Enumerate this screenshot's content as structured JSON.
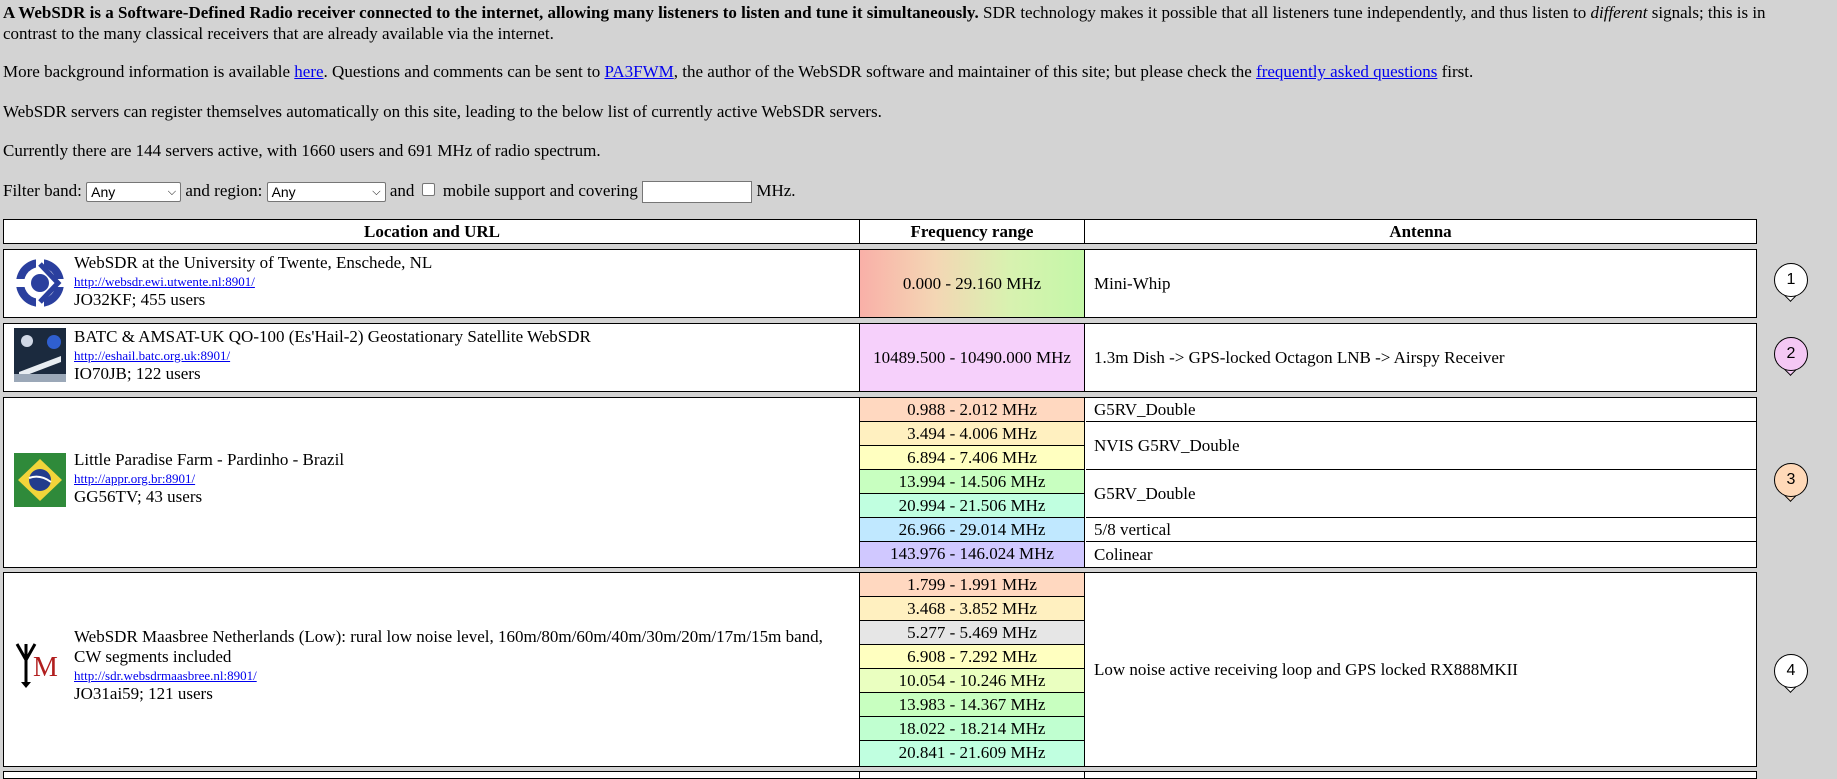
{
  "intro": {
    "bold": "A WebSDR is a Software-Defined Radio receiver connected to the internet, allowing many listeners to listen and tune it simultaneously.",
    "rest1": " SDR technology makes it possible that all listeners tune independently, and thus listen to ",
    "italic": "different",
    "rest2": " signals; this is in",
    "line2": "contrast to the many classical receivers that are already available via the internet."
  },
  "background": {
    "t1": "More background information is available ",
    "link1": "here",
    "t2": ". Questions and comments can be sent to ",
    "link2": "PA3FWM",
    "t3": ", the author of the WebSDR software and maintainer of this site; but please check the ",
    "link3": "frequently asked questions",
    "t4": " first."
  },
  "register_text": "WebSDR servers can register themselves automatically on this site, leading to the below list of currently active WebSDR servers.",
  "stats_text": "Currently there are 144 servers active, with 1660 users and 691 MHz of radio spectrum.",
  "filter": {
    "label_band": "Filter band:",
    "band_value": "Any",
    "label_region": "and region:",
    "region_value": "Any",
    "label_and": "and",
    "label_mobile": "mobile support and covering",
    "mhz_value": "",
    "label_mhz": "MHz."
  },
  "table": {
    "headers": [
      "Location and URL",
      "Frequency range",
      "Antenna"
    ]
  },
  "servers": [
    {
      "name": "WebSDR at the University of Twente, Enschede, NL",
      "url": "http://websdr.ewi.utwente.nl:8901/",
      "grid": "JO32KF; 455 users",
      "badge": "1",
      "badge_color": "#ffffff",
      "freqs": [
        {
          "range": "0.000 - 29.160 MHz",
          "color": "gradient-red-green"
        }
      ],
      "antennas": [
        "Mini-Whip"
      ]
    },
    {
      "name": "BATC & AMSAT-UK QO-100 (Es'Hail-2) Geostationary Satellite WebSDR",
      "url": "http://eshail.batc.org.uk:8901/",
      "grid": "IO70JB; 122 users",
      "badge": "2",
      "badge_color": "#f4c8f4",
      "freqs": [
        {
          "range": "10489.500 - 10490.000 MHz",
          "color": "#f6d0fb"
        }
      ],
      "antennas": [
        "1.3m Dish -> GPS-locked Octagon LNB -> Airspy Receiver"
      ]
    },
    {
      "name": "Little Paradise Farm - Pardinho - Brazil",
      "url": "http://appr.org.br:8901/",
      "grid": "GG56TV; 43 users",
      "badge": "3",
      "badge_color": "#ffd9b8",
      "freqs": [
        {
          "range": "0.988 - 2.012 MHz",
          "color": "#ffd8c0"
        },
        {
          "range": "3.494 - 4.006 MHz",
          "color": "#fff0c0"
        },
        {
          "range": "6.894 - 7.406 MHz",
          "color": "#ffffc0"
        },
        {
          "range": "13.994 - 14.506 MHz",
          "color": "#c8ffc0"
        },
        {
          "range": "20.994 - 21.506 MHz",
          "color": "#c0ffe0"
        },
        {
          "range": "26.966 - 29.014 MHz",
          "color": "#c0e8ff"
        },
        {
          "range": "143.976 - 146.024 MHz",
          "color": "#d0c8ff"
        }
      ],
      "antennas": [
        "G5RV_Double",
        "NVIS G5RV_Double",
        "G5RV_Double",
        "5/8 vertical",
        "Colinear"
      ]
    },
    {
      "name": "WebSDR Maasbree Netherlands (Low): rural low noise level, 160m/80m/60m/40m/30m/20m/17m/15m band,",
      "name2": "CW segments included",
      "url": "http://sdr.websdrmaasbree.nl:8901/",
      "grid": "JO31ai59; 121 users",
      "badge": "4",
      "badge_color": "#ffffff",
      "logo_text": "M",
      "freqs": [
        {
          "range": "1.799 - 1.991 MHz",
          "color": "#ffd8c0"
        },
        {
          "range": "3.468 - 3.852 MHz",
          "color": "#fff0c0"
        },
        {
          "range": "5.277 - 5.469 MHz",
          "color": "#e6e6e6"
        },
        {
          "range": "6.908 - 7.292 MHz",
          "color": "#ffffc0"
        },
        {
          "range": "10.054 - 10.246 MHz",
          "color": "#eaffc0"
        },
        {
          "range": "13.983 - 14.367 MHz",
          "color": "#c8ffc0"
        },
        {
          "range": "18.022 - 18.214 MHz",
          "color": "#c0ffd0"
        },
        {
          "range": "20.841 - 21.609 MHz",
          "color": "#c0ffe0"
        }
      ],
      "antennas": [
        "Low noise active receiving loop and GPS locked RX888MKII"
      ]
    }
  ]
}
